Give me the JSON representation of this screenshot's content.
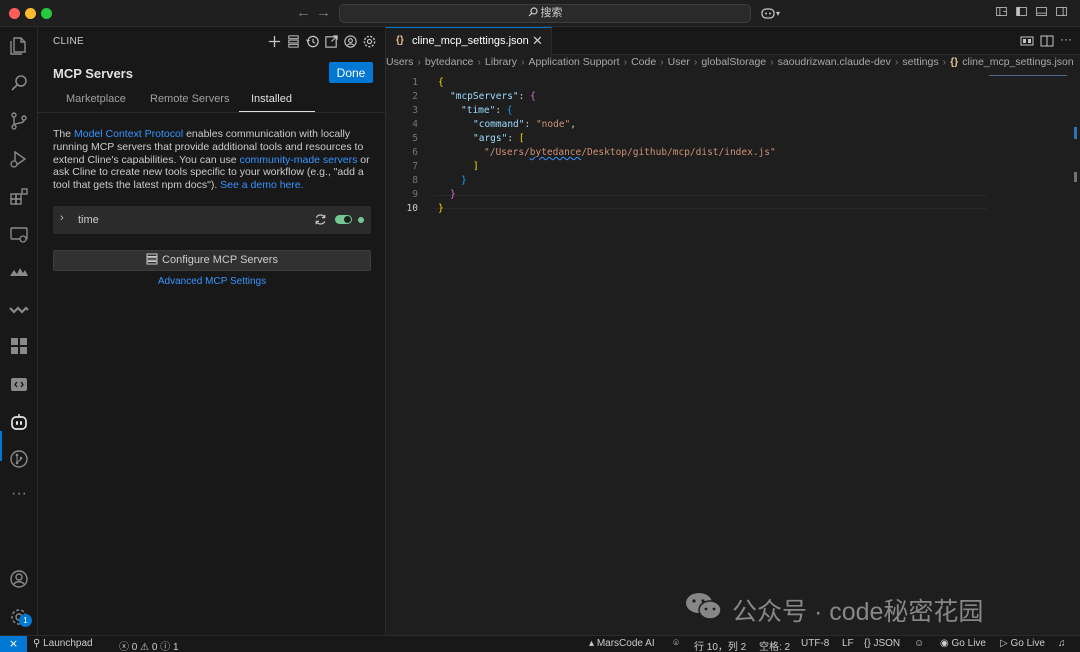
{
  "window": {
    "search_placeholder": "搜索",
    "search_icon": "search-icon"
  },
  "sidebar": {
    "title": "CLINE",
    "heading": "MCP Servers",
    "done_label": "Done",
    "tabs": [
      {
        "label": "Marketplace"
      },
      {
        "label": "Remote Servers"
      },
      {
        "label": "Installed"
      }
    ],
    "selected_tab": "Installed",
    "description": {
      "p1": "The ",
      "link1": "Model Context Protocol",
      "p2": " enables communication with locally running MCP servers that provide additional tools and resources to extend Cline's capabilities. You can use ",
      "link2": "community-made servers",
      "p3": " or ask Cline to create new tools specific to your workflow (e.g., \"add a tool that gets the latest npm docs\"). ",
      "link3": "See a demo here."
    },
    "servers": [
      {
        "name": "time",
        "enabled": true,
        "status_color": "#73c991"
      }
    ],
    "configure_label": "Configure MCP Servers",
    "advanced_label": "Advanced MCP Settings"
  },
  "editor": {
    "tab_icon": "{}",
    "tab_label": "cline_mcp_settings.json",
    "close_glyph": "✕",
    "breadcrumbs": [
      "Users",
      "bytedance",
      "Library",
      "Application Support",
      "Code",
      "User",
      "globalStorage",
      "saoudrizwan.claude-dev",
      "settings"
    ],
    "breadcrumb_file_icon": "{}",
    "breadcrumb_file": "cline_mcp_settings.json",
    "line_numbers": [
      "1",
      "2",
      "3",
      "4",
      "5",
      "6",
      "7",
      "8",
      "9",
      "10"
    ],
    "code": {
      "l1_open": "{",
      "l2_key": "\"mcpServers\"",
      "l2_colon": ": ",
      "l2_open": "{",
      "l3_key": "\"time\"",
      "l3_colon": ": ",
      "l3_open": "{",
      "l4_key": "\"command\"",
      "l4_colon": ": ",
      "l4_val": "\"node\"",
      "l4_comma": ",",
      "l5_key": "\"args\"",
      "l5_colon": ": ",
      "l5_open": "[",
      "l6_val_pre": "\"/Users/",
      "l6_val_user": "bytedance",
      "l6_val_post": "/Desktop/github/mcp/dist/index.js\"",
      "l7_close": "]",
      "l8_close": "}",
      "l9_close": "}",
      "l10_close": "}"
    },
    "accent": "#0078d4"
  },
  "watermark": {
    "text": "公众号 · code秘密花园"
  },
  "statusbar": {
    "remote_glyph": "⨯",
    "launchpad": "Launchpad",
    "errors": "0",
    "warnings": "0",
    "infos": "1",
    "marscode": "MarsCode AI",
    "cursor_pos": "行 10，列 2",
    "spaces": "空格: 2",
    "encoding": "UTF-8",
    "eol": "LF",
    "language": "JSON",
    "go_live_1": "Go Live",
    "go_live_2": "Go Live"
  },
  "activity": {
    "settings_badge": "1"
  }
}
